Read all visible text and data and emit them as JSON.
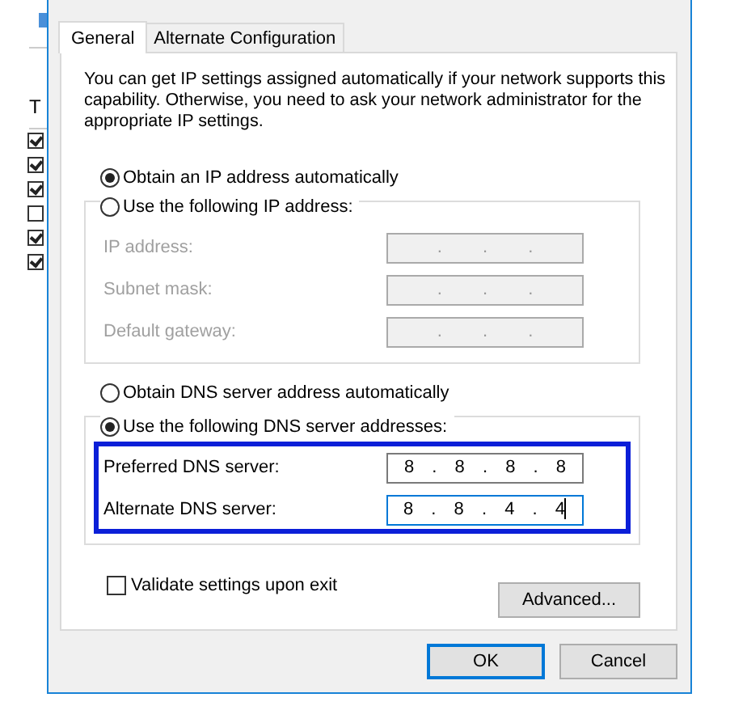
{
  "background_window": {
    "heading": "T",
    "checkboxes": [
      {
        "checked": true
      },
      {
        "checked": true
      },
      {
        "checked": true
      },
      {
        "checked": false
      },
      {
        "checked": true
      },
      {
        "checked": true
      }
    ]
  },
  "tabs": [
    {
      "label": "General",
      "selected": true
    },
    {
      "label": "Alternate Configuration",
      "selected": false
    }
  ],
  "description": "You can get IP settings assigned automatically if your network supports this capability. Otherwise, you need to ask your network administrator for the appropriate IP settings.",
  "ip_mode": [
    {
      "label": "Obtain an IP address automatically",
      "selected": true
    },
    {
      "label": "Use the following IP address:",
      "selected": false
    }
  ],
  "ip_fields": [
    {
      "label": "IP address:",
      "value": ". . .",
      "disabled": true,
      "focused": false
    },
    {
      "label": "Subnet mask:",
      "value": ". . .",
      "disabled": true,
      "focused": false
    },
    {
      "label": "Default gateway:",
      "value": ". . .",
      "disabled": true,
      "focused": false
    }
  ],
  "dns_mode": [
    {
      "label": "Obtain DNS server address automatically",
      "selected": false
    },
    {
      "label": "Use the following DNS server addresses:",
      "selected": true
    }
  ],
  "dns_highlighted": true,
  "dns_fields": [
    {
      "label": "Preferred DNS server:",
      "value": "8 . 8 . 8 . 8",
      "disabled": false,
      "focused": false
    },
    {
      "label": "Alternate DNS server:",
      "value": "8 . 8 . 4 . 4",
      "disabled": false,
      "focused": true
    }
  ],
  "validate": {
    "label": "Validate settings upon exit",
    "checked": false
  },
  "advanced_button": "Advanced...",
  "buttons": [
    {
      "label": "OK",
      "default": true
    },
    {
      "label": "Cancel",
      "default": false
    }
  ]
}
